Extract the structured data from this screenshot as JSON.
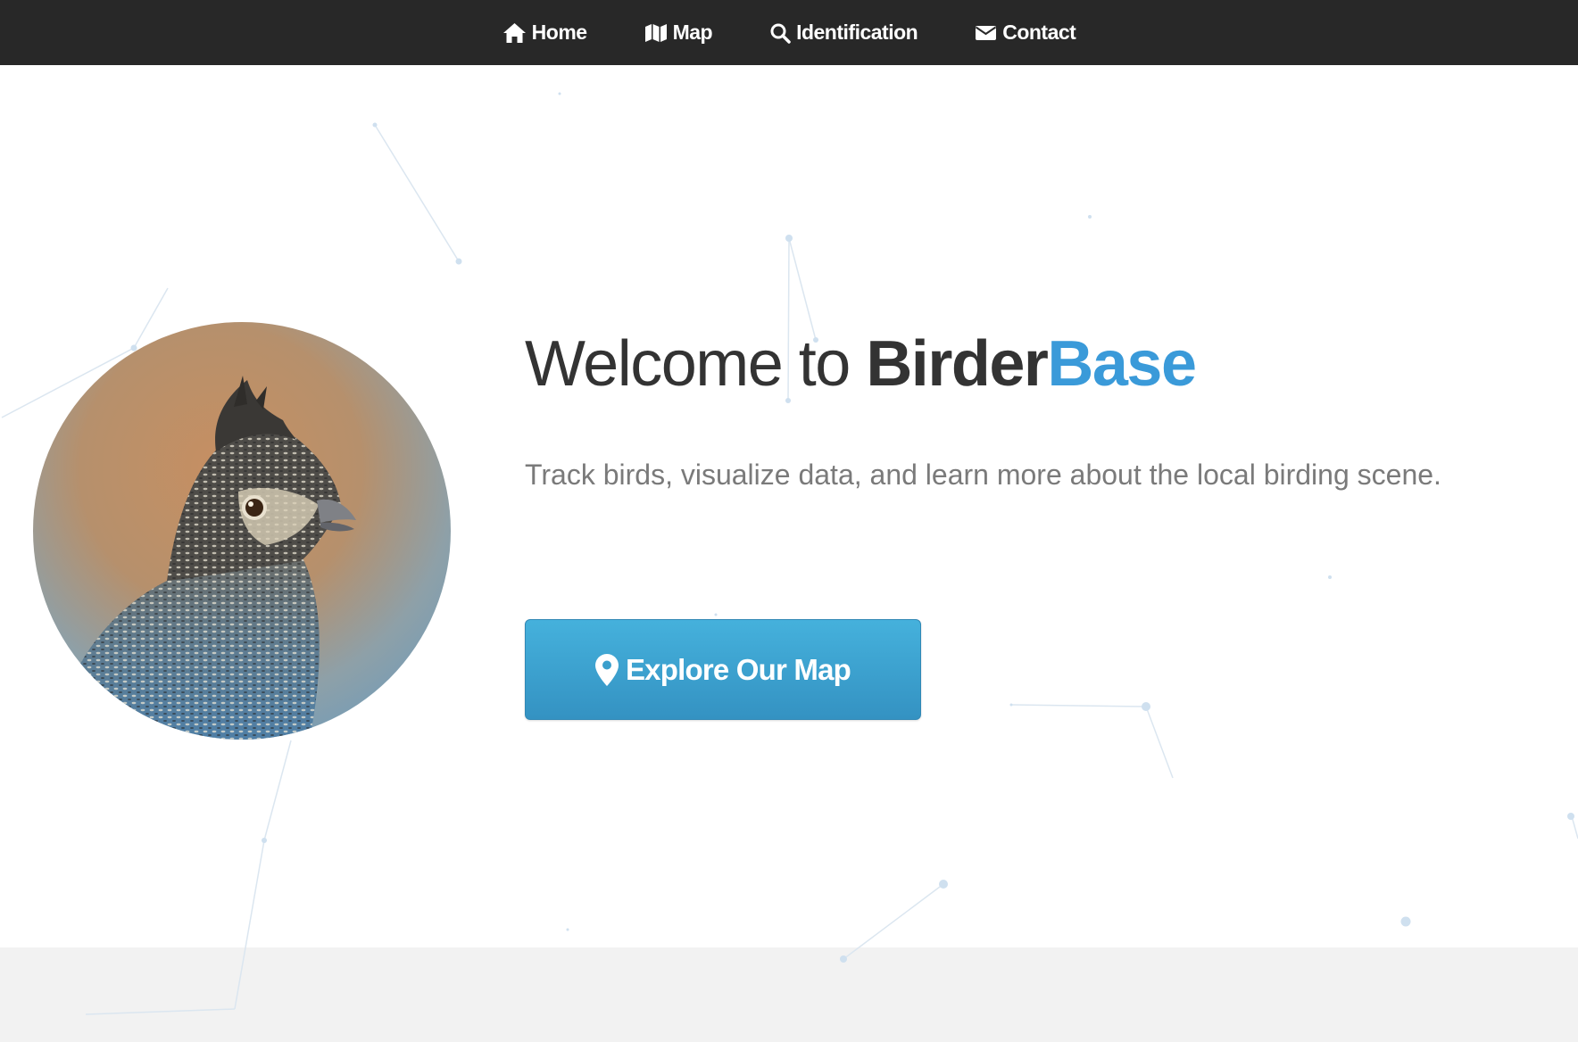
{
  "nav": {
    "items": [
      {
        "label": "Home",
        "icon": "home-icon"
      },
      {
        "label": "Map",
        "icon": "map-icon"
      },
      {
        "label": "Identification",
        "icon": "search-icon"
      },
      {
        "label": "Contact",
        "icon": "envelope-icon"
      }
    ]
  },
  "hero": {
    "title_prefix": "Welcome to ",
    "brand_first": "Birder",
    "brand_second": "Base",
    "tagline": "Track birds, visualize data, and learn more about the local birding scene.",
    "cta_label": "Explore Our Map",
    "cta_icon": "map-marker-icon",
    "image": "ruffed-grouse-photo"
  },
  "colors": {
    "navbar": "#282828",
    "brand_blue": "#3a9ad9",
    "button": "#3a9fcc",
    "text_dark": "#333333",
    "text_muted": "#7a7a7a",
    "footer_band": "#f2f2f2"
  }
}
